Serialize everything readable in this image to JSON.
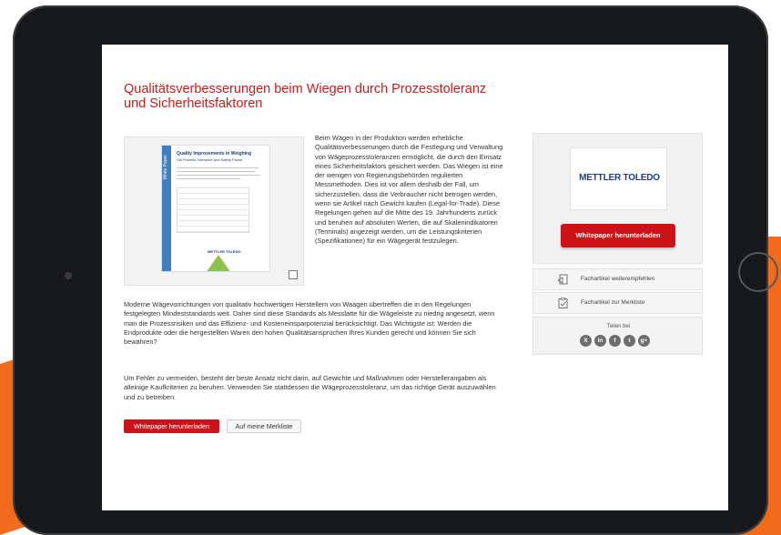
{
  "article": {
    "title_line1": "Qualitätsverbesserungen beim Wiegen durch Prozesstoleranz",
    "title_line2": "und Sicherheitsfaktoren",
    "intro_text": "Beim Wägen in der Produktion werden erhebliche Qualitätsverbesserungen durch die Festlegung und Verwaltung von Wägeprozesstoleranzen ermöglicht, die durch den Einsatz eines Sicherheitsfaktors gesichert werden. Das Wiegen ist eine der wenigen von Regierungsbehörden regulierten Messmethoden. Dies ist vor allem deshalb der Fall, um sicherzustellen, dass die Verbraucher nicht betrogen werden, wenn sie Artikel nach Gewicht kaufen (Legal-for-Trade). Diese Regelungen gehen auf die Mitte des 19. Jahrhunderts zurück und beruhen auf absoluten Werten, die auf Skalenindikatoren (Terminals) angezeigt werden, um die Leistungskriterien (Spezifikationen) für ein Wägegerät festzulegen.",
    "paragraph1": "Moderne Wägevorrichtungen von qualitativ hochwertigen Herstellern von Waagen übertreffen die in den Regelungen festgelegten Mindeststandards weit. Daher sind diese Standards als Messlatte für die Wägeleiste zu niedrig angesetzt, wenn man die Prozessrisiken und das Effizienz- und Kosteneinsparpotenzial berücksichtigt. Das Wichtigste ist: Werden die Endprodukte oder die hergestellten Waren den hohen Qualitätsansprüchen Ihres Kunden gerecht und können Sie sich bewähren?",
    "paragraph2": "Um Fehler zu vermeiden, besteht der beste Ansatz nicht darin, auf Gewichte und Maßnahmen oder Herstellerangaben als alleinige Kaufkriterien zu beruhen. Verwenden Sie stattdessen die Wägeprozesstoleranz, um das richtige Gerät auszuwählen und zu betreiben.",
    "download_button": "Whitepaper herunterladen",
    "watchlist_button": "Auf meine Merkliste"
  },
  "thumbnail": {
    "band_text": "White Paper",
    "doc_title": "Quality Improvements in Weighing",
    "doc_subtitle": "Via Process Tolerance and Safety Factor",
    "logo_text": "METTLER TOLEDO",
    "zoom_icon": "expand-icon"
  },
  "sidebar": {
    "logo_text": "METTLER TOLEDO",
    "download_button": "Whitepaper herunterladen",
    "recommend_label": "Fachartikel weiterempfehlen",
    "recommend_icon": "recommend-icon",
    "watchlist_label": "Fachartikel zur Merkliste",
    "watchlist_icon": "clipboard-check-icon",
    "share_label": "Teilen bei",
    "share_icons": [
      {
        "name": "xing-icon",
        "glyph": "X"
      },
      {
        "name": "linkedin-icon",
        "glyph": "in"
      },
      {
        "name": "facebook-icon",
        "glyph": "f"
      },
      {
        "name": "twitter-icon",
        "glyph": "t"
      },
      {
        "name": "google-plus-icon",
        "glyph": "g+"
      }
    ]
  },
  "colors": {
    "accent_red": "#cc1418",
    "title_red": "#cc1a1a",
    "logo_blue": "#1f3d8a",
    "background_orange": "#f26a1b"
  }
}
